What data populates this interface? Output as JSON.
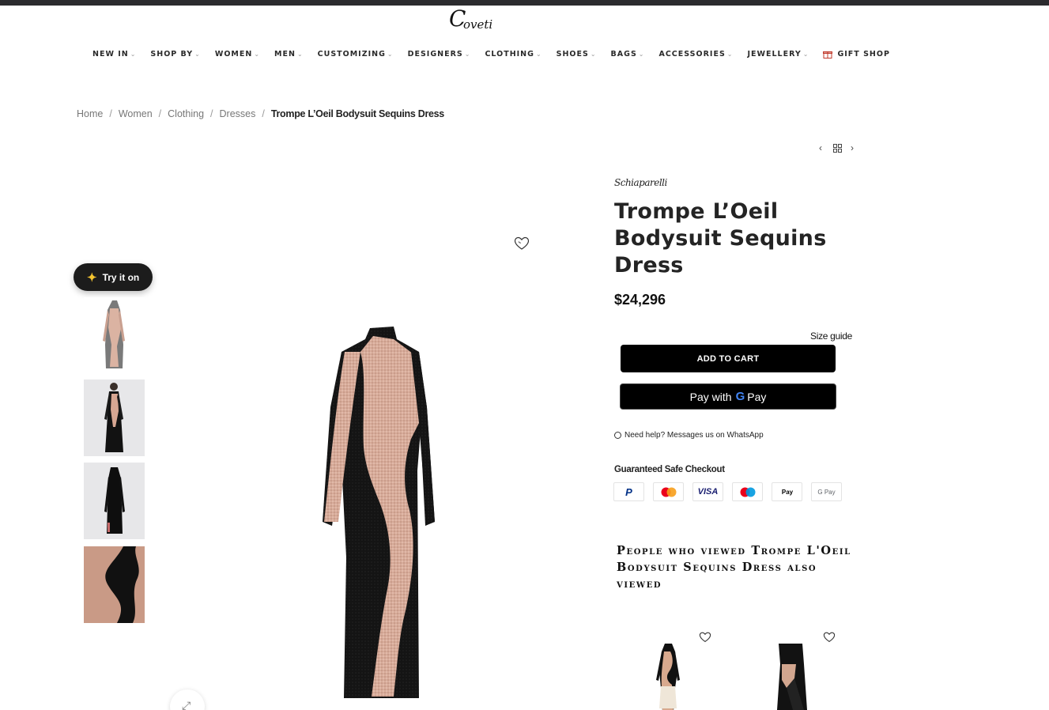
{
  "site": {
    "logo_text": "Coveti"
  },
  "nav": {
    "items": [
      {
        "label": "NEW IN"
      },
      {
        "label": "SHOP BY"
      },
      {
        "label": "WOMEN"
      },
      {
        "label": "MEN"
      },
      {
        "label": "CUSTOMIZING"
      },
      {
        "label": "DESIGNERS"
      },
      {
        "label": "CLOTHING"
      },
      {
        "label": "SHOES"
      },
      {
        "label": "BAGS"
      },
      {
        "label": "ACCESSORIES"
      },
      {
        "label": "JEWELLERY"
      }
    ],
    "gift_label": "GIFT SHOP"
  },
  "breadcrumb": {
    "items": [
      "Home",
      "Women",
      "Clothing",
      "Dresses"
    ],
    "current": "Trompe L’Oeil Bodysuit Sequins Dress",
    "separator": "/"
  },
  "gallery": {
    "try_on_label": "Try it on",
    "colors": {
      "sequin": "#d9aa9a",
      "black": "#151515"
    }
  },
  "product": {
    "brand": "Schiaparelli",
    "title": "Trompe L’Oeil Bodysuit Sequins Dress",
    "price": "$24,296",
    "size_guide": "Size guide",
    "add_to_cart": "ADD TO CART",
    "gpay_prefix": "Pay with",
    "gpay_brand": "Pay",
    "whatsapp": "Need help? Messages us on WhatsApp",
    "safe_checkout": "Guaranteed Safe Checkout",
    "payment_methods": [
      {
        "name": "paypal-icon",
        "label": "P",
        "color": "#003087"
      },
      {
        "name": "mastercard-icon",
        "label": "",
        "color": "#eb001b"
      },
      {
        "name": "visa-icon",
        "label": "VISA",
        "color": "#1a1f71"
      },
      {
        "name": "maestro-icon",
        "label": "",
        "color": "#0099df"
      },
      {
        "name": "apple-pay-icon",
        "label": "Pay",
        "color": "#000000"
      },
      {
        "name": "google-pay-icon",
        "label": "G Pay",
        "color": "#5f6368"
      }
    ]
  },
  "related": {
    "heading": "People who viewed Trompe L'Oeil Bodysuit Sequins Dress also viewed"
  }
}
